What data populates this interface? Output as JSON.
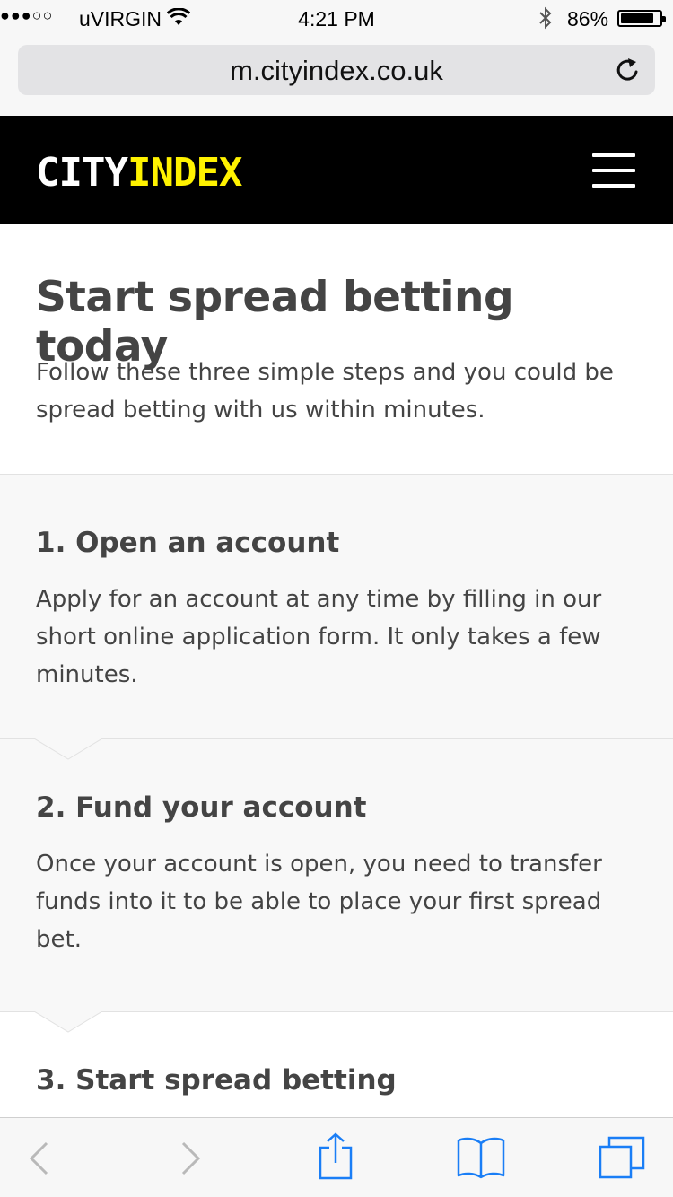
{
  "status_bar": {
    "signal": "●●●○○",
    "carrier": "uVIRGIN",
    "time": "4:21 PM",
    "battery_percent": "86%",
    "battery_level": 0.86
  },
  "browser": {
    "url": "m.cityindex.co.uk"
  },
  "site": {
    "logo_part1": "CITY",
    "logo_part2": "INDEX",
    "logo_color_primary": "#ffffff",
    "logo_color_accent": "#fff200"
  },
  "intro": {
    "title": "Start spread betting today",
    "text": "Follow these three simple steps and you could be spread betting with us within minutes."
  },
  "steps": [
    {
      "title": "1. Open an account",
      "text": "Apply for an account at any time by filling in our short online application form. It only takes a few minutes."
    },
    {
      "title": "2. Fund your account",
      "text": "Once your account is open, you need to transfer funds into it to be able to place your first spread bet."
    },
    {
      "title": "3. Start spread betting"
    }
  ],
  "toolbar": {
    "icons": [
      "back-icon",
      "forward-icon",
      "share-icon",
      "bookmarks-icon",
      "tabs-icon"
    ],
    "accent_color": "#1a7ef6"
  }
}
